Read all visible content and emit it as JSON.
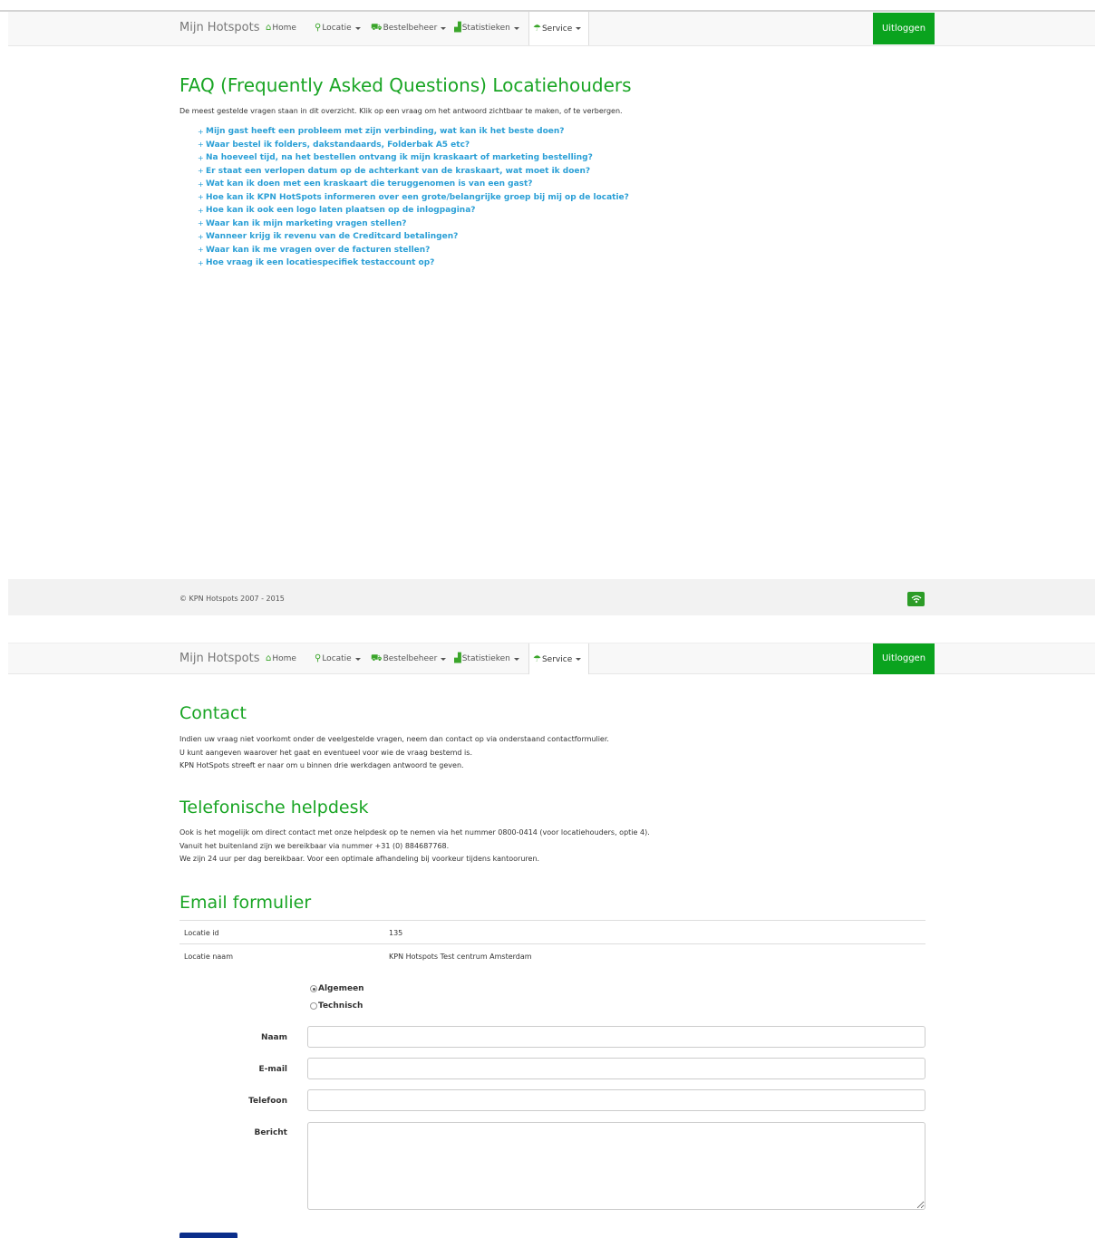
{
  "nav": {
    "brand": "Mijn Hotspots",
    "items": [
      {
        "label": "Home",
        "icon": "home-icon"
      },
      {
        "label": "Locatie",
        "icon": "location-pin-icon"
      },
      {
        "label": "Bestelbeheer",
        "icon": "cart-icon"
      },
      {
        "label": "Statistieken",
        "icon": "bar-chart-icon"
      },
      {
        "label": "Service",
        "icon": "service-icon"
      }
    ],
    "logout_label": "Uitloggen"
  },
  "faq": {
    "title": "FAQ (Frequently Asked Questions) Locatiehouders",
    "intro": "De meest gestelde vragen staan in dit overzicht. Klik op een vraag om het antwoord zichtbaar te maken, of te verbergen.",
    "questions": [
      "Mijn gast heeft een probleem met zijn verbinding, wat kan ik het beste doen?",
      "Waar bestel ik folders, dakstandaards, Folderbak A5 etc?",
      "Na hoeveel tijd, na het bestellen ontvang ik mijn kraskaart of marketing bestelling?",
      "Er staat een verlopen datum op de achterkant van de kraskaart, wat moet ik doen?",
      "Wat kan ik doen met een kraskaart die teruggenomen is van een gast?",
      "Hoe kan ik KPN HotSpots informeren over een grote/belangrijke groep bij mij op de locatie?",
      "Hoe kan ik ook een logo laten plaatsen op de inlogpagina?",
      "Waar kan ik mijn marketing vragen stellen?",
      "Wanneer krijg ik revenu van de Creditcard betalingen?",
      "Waar kan ik me vragen over de facturen stellen?",
      "Hoe vraag ik een locatiespecifiek testaccount op?"
    ]
  },
  "footer": {
    "copyright": "© KPN Hotspots 2007 - 2015"
  },
  "contact": {
    "title": "Contact",
    "lines": [
      "Indien uw vraag niet voorkomt onder de veelgestelde vragen, neem dan contact op via onderstaand contactformulier.",
      "U kunt aangeven waarover het gaat en eventueel voor wie de vraag bestemd is.",
      "KPN HotSpots streeft er naar om u binnen drie werkdagen antwoord te geven."
    ]
  },
  "helpdesk": {
    "title": "Telefonische helpdesk",
    "lines": [
      "Ook is het mogelijk om direct contact met onze helpdesk op te nemen via het nummer 0800-0414 (voor locatiehouders, optie 4).",
      "Vanuit het buitenland zijn we bereikbaar via nummer +31 (0) 884687768.",
      "We zijn 24 uur per dag bereikbaar. Voor een optimale afhandeling bij voorkeur tijdens kantooruren."
    ]
  },
  "email_form": {
    "title": "Email formulier",
    "info": [
      {
        "label": "Locatie id",
        "value": "135"
      },
      {
        "label": "Locatie naam",
        "value": "KPN Hotspots Test centrum Amsterdam"
      }
    ],
    "radio_options": [
      {
        "label": "Algemeen",
        "checked": true
      },
      {
        "label": "Technisch",
        "checked": false
      }
    ],
    "fields": {
      "naam": {
        "label": "Naam",
        "value": ""
      },
      "email": {
        "label": "E-mail",
        "value": ""
      },
      "telefoon": {
        "label": "Telefoon",
        "value": ""
      },
      "bericht": {
        "label": "Bericht",
        "value": ""
      }
    }
  },
  "colors": {
    "brand_green": "#19a524",
    "logout_green": "#0aa31e",
    "link_blue": "#2a9fd6",
    "send_button": "#0b2e8a"
  }
}
